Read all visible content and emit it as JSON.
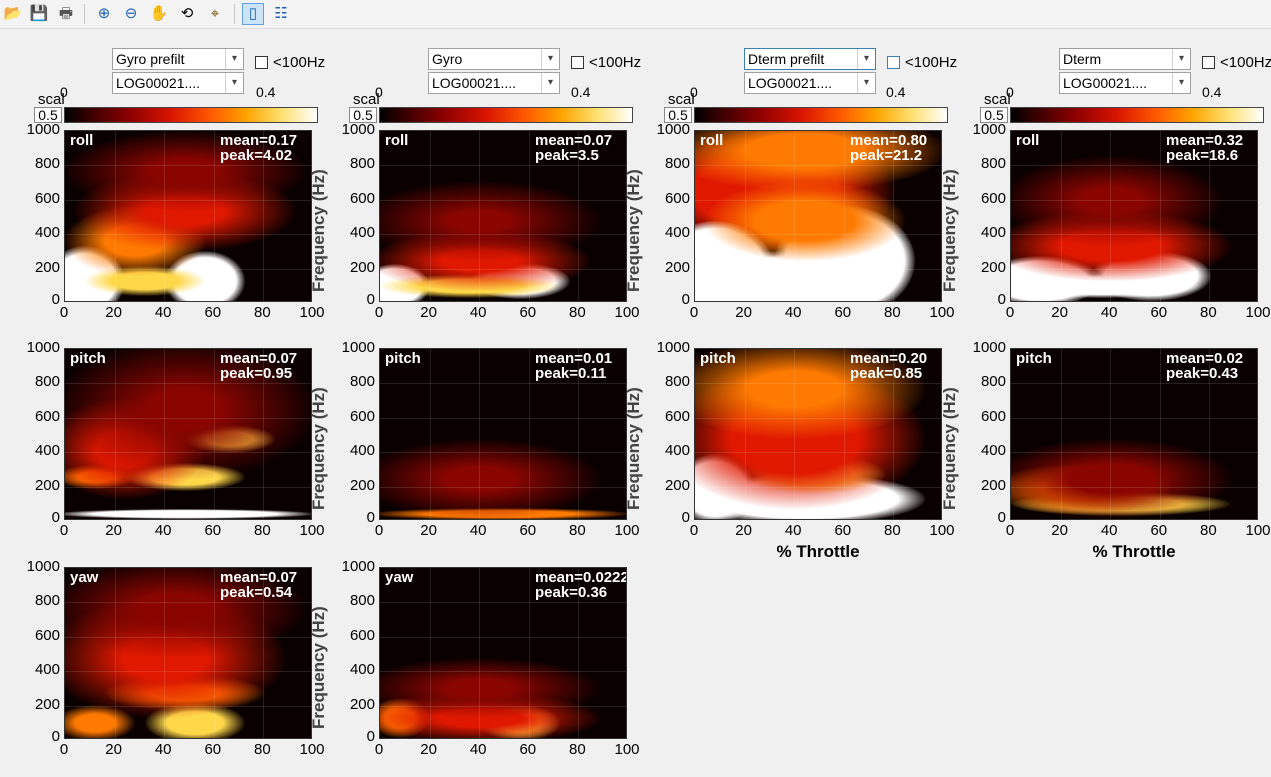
{
  "toolbar": {
    "icons": [
      "open-icon",
      "save-icon",
      "print-icon",
      "zoom-in-icon",
      "zoom-out-icon",
      "pan-hand-icon",
      "rotate-icon",
      "data-cursor-icon",
      "layout-icon",
      "legend-icon"
    ]
  },
  "columns": [
    {
      "source": "Gyro prefilt",
      "file": "LOG00021....",
      "filter_label": "<100Hz",
      "scal_label": "scal",
      "scal_value": "0.5",
      "cbar_min": "0",
      "cbar_max": "0.4"
    },
    {
      "source": "Gyro",
      "file": "LOG00021....",
      "filter_label": "<100Hz",
      "scal_label": "scal",
      "scal_value": "0.5",
      "cbar_min": "0",
      "cbar_max": "0.4"
    },
    {
      "source": "Dterm prefilt",
      "file": "LOG00021....",
      "filter_label": "<100Hz",
      "scal_label": "scal",
      "scal_value": "0.5",
      "cbar_min": "0",
      "cbar_max": "0.4"
    },
    {
      "source": "Dterm",
      "file": "LOG00021....",
      "filter_label": "<100Hz",
      "scal_label": "scal",
      "scal_value": "0.5",
      "cbar_min": "0",
      "cbar_max": "0.4"
    }
  ],
  "axes": {
    "y_ticks": [
      "1000",
      "800",
      "600",
      "400",
      "200",
      "0"
    ],
    "x_ticks": [
      "0",
      "20",
      "40",
      "60",
      "80",
      "100"
    ],
    "xlabel": "% Throttle",
    "ylabel": "Frequency (Hz)"
  },
  "plots": [
    {
      "axis": "roll",
      "mean": "mean=0.17",
      "peak": "peak=4.02"
    },
    {
      "axis": "roll",
      "mean": "mean=0.07",
      "peak": "peak=3.5"
    },
    {
      "axis": "roll",
      "mean": "mean=0.80",
      "peak": "peak=21.2"
    },
    {
      "axis": "roll",
      "mean": "mean=0.32",
      "peak": "peak=18.6"
    },
    {
      "axis": "pitch",
      "mean": "mean=0.07",
      "peak": "peak=0.95"
    },
    {
      "axis": "pitch",
      "mean": "mean=0.01",
      "peak": "peak=0.11"
    },
    {
      "axis": "pitch",
      "mean": "mean=0.20",
      "peak": "peak=0.85"
    },
    {
      "axis": "pitch",
      "mean": "mean=0.02",
      "peak": "peak=0.43"
    },
    {
      "axis": "yaw",
      "mean": "mean=0.07",
      "peak": "peak=0.54"
    },
    {
      "axis": "yaw",
      "mean": "mean=0.0222",
      "peak": "peak=0.36"
    }
  ]
}
